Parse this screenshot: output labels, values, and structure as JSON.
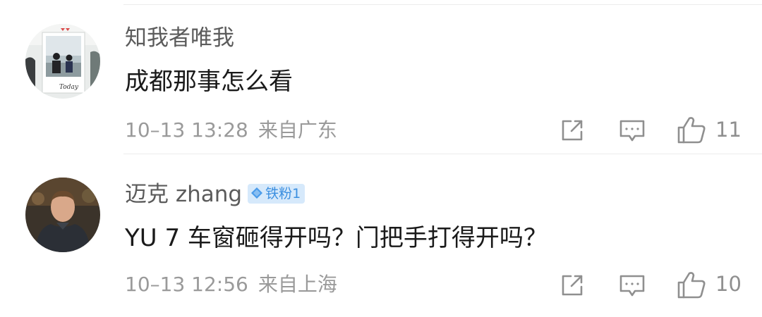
{
  "comments": [
    {
      "username": "知我者唯我",
      "text": "成都那事怎么看",
      "time": "10–13 13:28",
      "location": "来自广东",
      "likes": "11",
      "avatar_caption": "Today"
    },
    {
      "username": "迈克 zhang",
      "badge": "铁粉1",
      "text": "YU 7 车窗砸得开吗？门把手打得开吗？",
      "time": "10–13 12:56",
      "location": "来自上海",
      "likes": "10"
    }
  ],
  "icons": {
    "share": "share-icon",
    "reply": "comment-icon",
    "like": "thumbs-up-icon",
    "badge": "diamond-icon"
  },
  "colors": {
    "username": "#5b5b5b",
    "text": "#1a1a1a",
    "meta": "#9a9a9a",
    "badge_bg": "#d6e9fb",
    "badge_text": "#3b8fe0"
  }
}
